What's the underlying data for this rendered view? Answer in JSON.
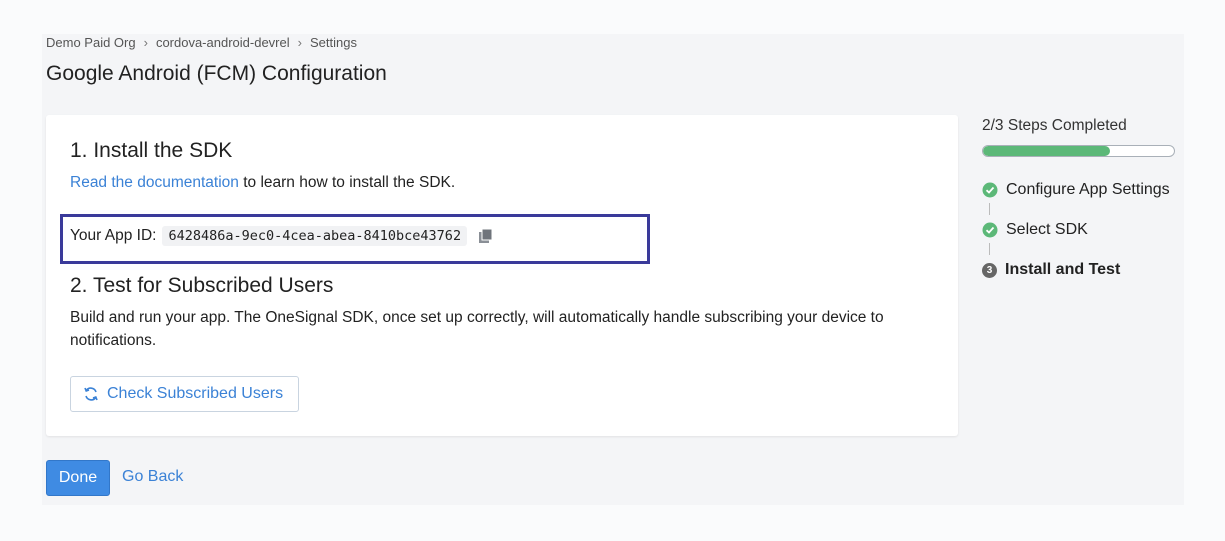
{
  "breadcrumb": {
    "items": [
      "Demo Paid Org",
      "cordova-android-devrel",
      "Settings"
    ],
    "separator": "›"
  },
  "page": {
    "title": "Google Android (FCM) Configuration"
  },
  "section1": {
    "heading": "1. Install the SDK",
    "link_text": "Read the documentation",
    "after_link": " to learn how to install the SDK.",
    "app_id_label": "Your App ID:",
    "app_id_value": "6428486a-9ec0-4cea-abea-8410bce43762"
  },
  "section2": {
    "heading": "2. Test for Subscribed Users",
    "description": "Build and run your app. The OneSignal SDK, once set up correctly, will automatically handle subscribing your device to notifications.",
    "check_button_label": "Check Subscribed Users"
  },
  "footer": {
    "done_label": "Done",
    "back_label": "Go Back"
  },
  "steps": {
    "summary": "2/3 Steps Completed",
    "progress_fraction": 0.667,
    "items": [
      {
        "label": "Configure App Settings",
        "status": "complete"
      },
      {
        "label": "Select SDK",
        "status": "complete"
      },
      {
        "label": "Install and Test",
        "status": "current",
        "number": "3"
      }
    ]
  },
  "colors": {
    "link": "#3b82d6",
    "primary_button": "#3f8be3",
    "progress": "#5cb878",
    "highlight_box": "#3a3a9a"
  },
  "icons": {
    "copy": "copy-icon",
    "refresh": "refresh-icon",
    "check": "check-circle-icon"
  }
}
